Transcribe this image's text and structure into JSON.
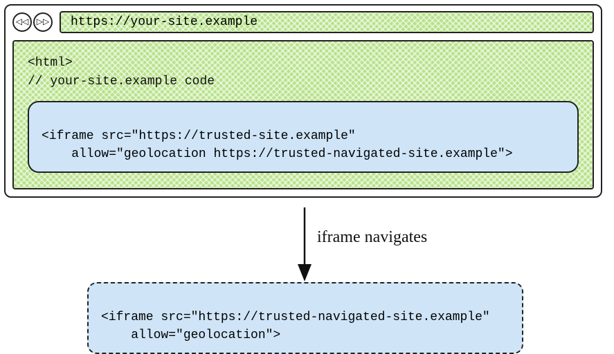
{
  "browser": {
    "url": "https://your-site.example",
    "back_glyph": "◁◁",
    "forward_glyph": "▷▷"
  },
  "page": {
    "code_line1": "<html>",
    "code_line2": "// your-site.example code",
    "iframe_line1": "<iframe src=\"https://trusted-site.example\"",
    "iframe_line2": "    allow=\"geolocation https://trusted-navigated-site.example\">"
  },
  "arrow_label": "iframe navigates",
  "result": {
    "iframe_line1": "<iframe src=\"https://trusted-navigated-site.example\"",
    "iframe_line2": "    allow=\"geolocation\">"
  }
}
